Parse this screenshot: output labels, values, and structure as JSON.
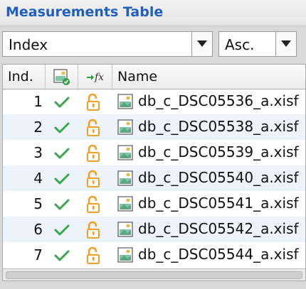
{
  "panel": {
    "title": "Measurements Table"
  },
  "sort": {
    "field": "Index",
    "order": "Asc."
  },
  "table": {
    "headers": {
      "index": "Ind.",
      "name": "Name"
    },
    "rows": [
      {
        "index": "1",
        "name": "db_c_DSC05536_a.xisf"
      },
      {
        "index": "2",
        "name": "db_c_DSC05538_a.xisf"
      },
      {
        "index": "3",
        "name": "db_c_DSC05539_a.xisf"
      },
      {
        "index": "4",
        "name": "db_c_DSC05540_a.xisf"
      },
      {
        "index": "5",
        "name": "db_c_DSC05541_a.xisf"
      },
      {
        "index": "6",
        "name": "db_c_DSC05542_a.xisf"
      },
      {
        "index": "7",
        "name": "db_c_DSC05544_a.xisf"
      }
    ]
  },
  "colors": {
    "title": "#1f5fbf",
    "check": "#3aa84a",
    "lock": "#f0a020",
    "row_alt": "#edf3fb"
  },
  "icons": {
    "approved_header": "approved-image-icon",
    "weight_header": "formula-icon",
    "approved": "checkmark-icon",
    "locked": "unlocked-padlock-icon",
    "file": "image-file-icon"
  }
}
